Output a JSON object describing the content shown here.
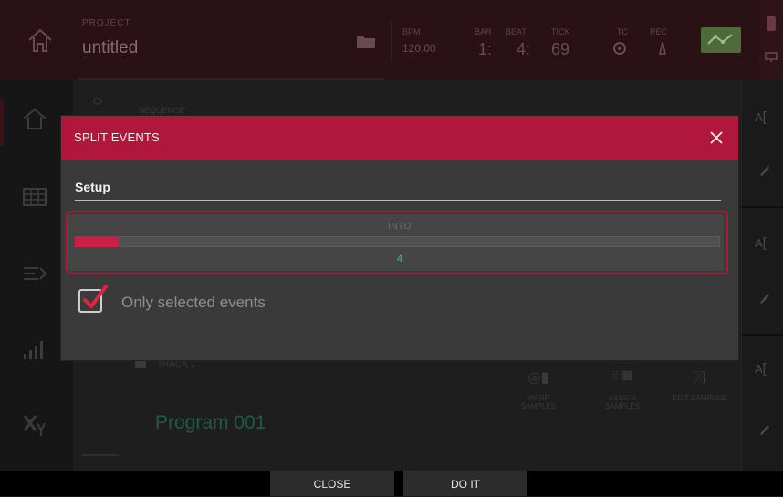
{
  "header": {
    "project_label": "PROJECT",
    "project_name": "untitled",
    "bpm_label": "BPM",
    "bpm_value": "120.00",
    "bar_label": "BAR",
    "bar_value": "1:",
    "beat_label": "BEAT",
    "beat_value": "4:",
    "tick_label": "TICK",
    "tick_value": "69",
    "tc_label": "TC",
    "record_label": "REC",
    "link_color": "#4d6a3a"
  },
  "background": {
    "sequence_label": "SEQUENCE",
    "program_name": "Program 001",
    "track_label": "TRACK 1",
    "tools": [
      {
        "label": "WARP SAMPLES",
        "icon": "warp-icon"
      },
      {
        "label": "ASSIGN SAMPLES",
        "icon": "assign-icon"
      },
      {
        "label": "EDIT SAMPLES",
        "icon": "edit-samples-icon"
      }
    ]
  },
  "dialog": {
    "title": "SPLIT EVENTS",
    "section": "Setup",
    "into_label": "INTO",
    "into_value": "4",
    "into_fraction": 0.068,
    "checkbox_label": "Only selected events",
    "checkbox_checked": true,
    "accent": "#b0173a",
    "value_color": "#3fb6a0"
  },
  "footer": {
    "close_label": "CLOSE",
    "doit_label": "DO IT"
  }
}
